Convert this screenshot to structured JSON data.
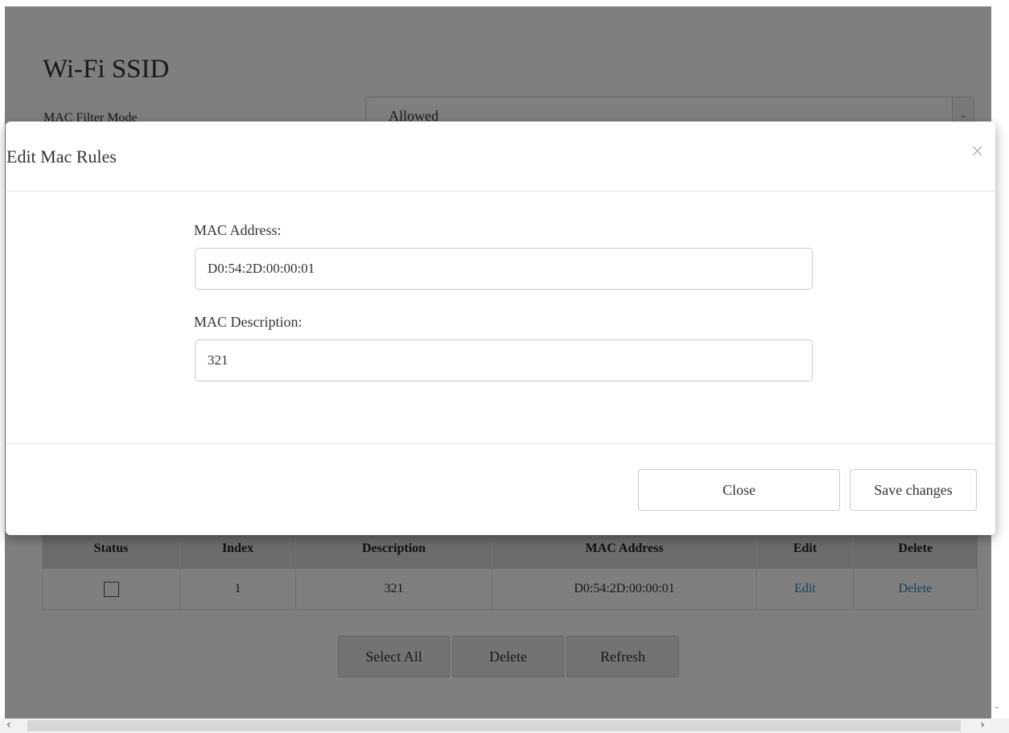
{
  "page": {
    "title": "Wi-Fi SSID",
    "mac_filter_mode_label": "MAC Filter Mode",
    "mac_filter_mode_value": "Allowed"
  },
  "rules_table": {
    "headers": [
      "Status",
      "Index",
      "Description",
      "MAC Address",
      "Edit",
      "Delete"
    ],
    "rows": [
      {
        "index": "1",
        "description": "321",
        "mac": "D0:54:2D:00:00:01",
        "edit": "Edit",
        "delete": "Delete"
      }
    ]
  },
  "actions": {
    "select_all": "Select All",
    "delete": "Delete",
    "refresh": "Refresh"
  },
  "modal": {
    "title": "Edit Mac Rules",
    "close_glyph": "×",
    "mac_address_label": "MAC Address:",
    "mac_address_value": "D0:54:2D:00:00:01",
    "mac_description_label": "MAC Description:",
    "mac_description_value": "321",
    "close_button": "Close",
    "save_button": "Save changes"
  },
  "colors": {
    "link": "#337ab7",
    "backdrop": "rgba(0,0,0,0.5)"
  }
}
